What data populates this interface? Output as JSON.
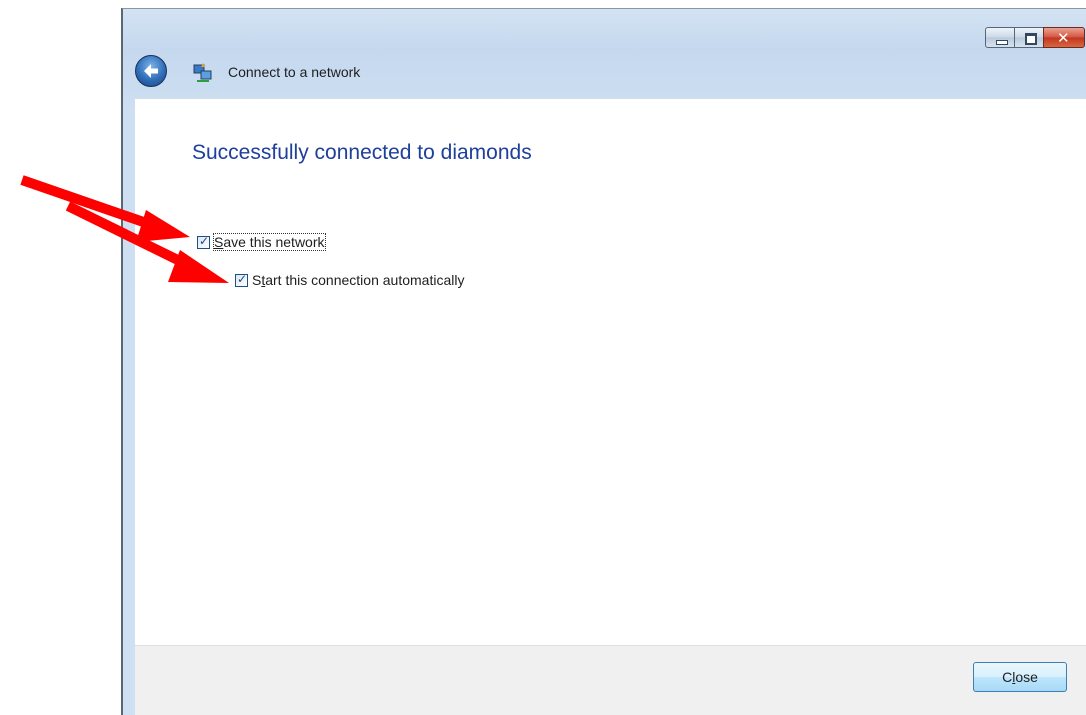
{
  "window": {
    "nav_title": "Connect to a network",
    "heading": "Successfully connected to diamonds"
  },
  "options": [
    {
      "label_prefix": "",
      "accel": "S",
      "label_rest": "ave this network",
      "checked": true
    },
    {
      "label_prefix": "S",
      "accel": "t",
      "label_rest": "art this connection automatically",
      "checked": true
    }
  ],
  "footer": {
    "close_prefix": "C",
    "close_accel": "l",
    "close_rest": "ose"
  },
  "icons": {
    "back": "back-arrow-icon",
    "network": "network-icon",
    "minimize": "minimize-icon",
    "maximize": "maximize-icon",
    "close": "close-icon"
  },
  "colors": {
    "heading": "#1e3f9a",
    "annotation_arrow": "#ff0000"
  },
  "checkmark": "✓",
  "close_glyph": "✕"
}
